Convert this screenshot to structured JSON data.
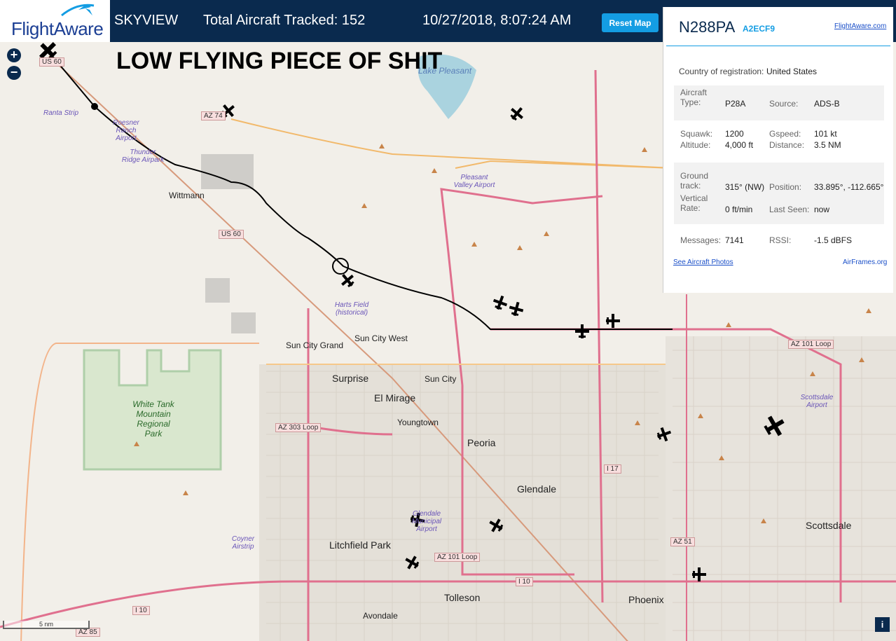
{
  "header": {
    "logo": "FlightAware",
    "app": "SKYVIEW",
    "total_label": "Total Aircraft Tracked: 152",
    "datetime": "10/27/2018, 8:07:24 AM",
    "reset_button": "Reset Map"
  },
  "overlay_caption": "LOW FLYING PIECE OF SHIT",
  "zoom": {
    "in": "+",
    "out": "−"
  },
  "panel": {
    "callsign": "N288PA",
    "hex": "A2ECF9",
    "flightaware_link": "FlightAware.com",
    "country_label": "Country of registration:",
    "country_value": "United States",
    "aircraft_type_label": "Aircraft Type:",
    "aircraft_type_value": "P28A",
    "source_label": "Source:",
    "source_value": "ADS-B",
    "squawk_label": "Squawk:",
    "squawk_value": "1200",
    "gspeed_label": "Gspeed:",
    "gspeed_value": "101 kt",
    "altitude_label": "Altitude:",
    "altitude_value": "4,000 ft",
    "distance_label": "Distance:",
    "distance_value": "3.5 NM",
    "ground_track_label": "Ground track:",
    "ground_track_value": "315° (NW)",
    "position_label": "Position:",
    "position_value": "33.895°, -112.665°",
    "vertical_rate_label": "Vertical Rate:",
    "vertical_rate_value": "0 ft/min",
    "last_seen_label": "Last Seen:",
    "last_seen_value": "now",
    "messages_label": "Messages:",
    "messages_value": "7141",
    "rssi_label": "RSSI:",
    "rssi_value": "-1.5 dBFS",
    "photos_link": "See Aircraft Photos",
    "airframes_link": "AirFrames.org"
  },
  "map": {
    "scale": "5 nm",
    "places": [
      "Wittmann",
      "Sun City Grand",
      "Sun City West",
      "Surprise",
      "El Mirage",
      "Sun City",
      "Youngtown",
      "Peoria",
      "Glendale",
      "Litchfield Park",
      "Tolleson",
      "Phoenix",
      "Scottsdale",
      "Avondale"
    ],
    "parks": [
      "White Tank Mountain Regional Park"
    ],
    "airports": [
      "Ranta Strip",
      "Roesner Ranch Airport",
      "Thunder Ridge Airpark",
      "Pleasant Valley Airport",
      "Harts Field (historical)",
      "Glendale Municipal Airport",
      "Coyner Airstrip",
      "Scottsdale Airport"
    ],
    "lakes": [
      "Lake Pleasant"
    ],
    "roads": [
      "US 60",
      "AZ 74",
      "US 60",
      "AZ 303 Loop",
      "AZ 101 Loop",
      "AZ 101 Loop",
      "I 17",
      "AZ 51",
      "I 10",
      "I 10",
      "AZ 85"
    ]
  }
}
